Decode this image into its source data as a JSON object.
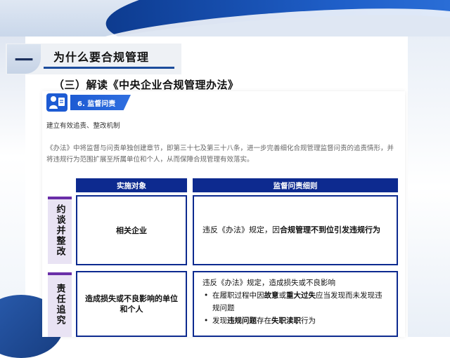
{
  "section": {
    "number": "一",
    "title": "为什么要合规管理",
    "subtitle": "（三）解读《中央企业合规管理办法》"
  },
  "card": {
    "badge_label": "6. 监督问责",
    "mechanism_title": "建立有效追责、整改机制",
    "paragraph": "《办法》中将监督与问责单独创建章节，即第三十七及第三十八条，进一步完善细化合规管理监督问责的追责情形，并将违规行为范围扩展至所属单位和个人，从而保障合规管理有效落实。"
  },
  "table": {
    "headers": [
      "实施对象",
      "监督问责细则"
    ],
    "rows": [
      {
        "category": "约谈并整改",
        "target": "相关企业",
        "detail_prefix": "违反《办法》规定，因",
        "detail_bold": "合规管理不到位引发违规行为",
        "detail_suffix": ""
      },
      {
        "category": "责任追究",
        "target": "造成损失或不良影响的单位和个人",
        "detail_intro": "违反《办法》规定，造成损失或不良影响",
        "bullet1_a": "在履职过程中因",
        "bullet1_b": "故意",
        "bullet1_c": "或",
        "bullet1_d": "重大过失",
        "bullet1_e": "应当发现而未发现违规问题",
        "bullet2_a": "发现",
        "bullet2_b": "违规问题",
        "bullet2_c": "存在",
        "bullet2_d": "失职渎职",
        "bullet2_e": "行为"
      }
    ]
  },
  "colors": {
    "header_blue": "#0d2a8f",
    "badge_blue": "#1d5bd3",
    "category_purple": "#6a2ea8",
    "category_bg": "#e9e3f4"
  }
}
